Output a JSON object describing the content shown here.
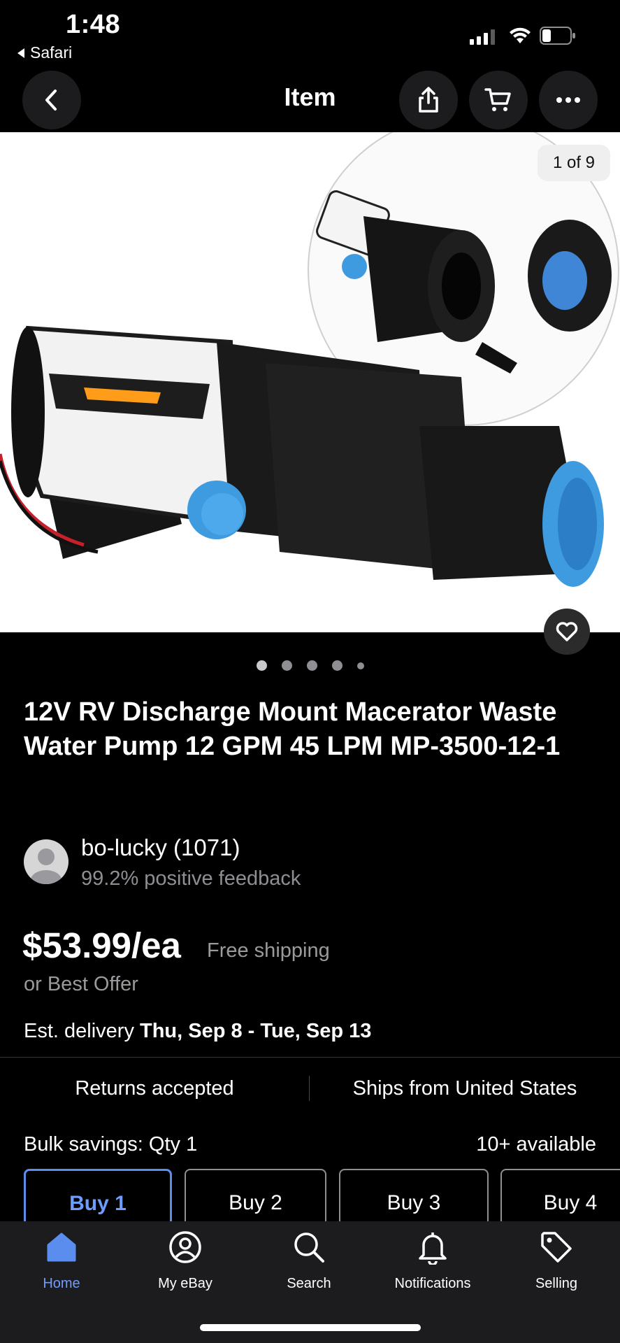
{
  "status_bar": {
    "time": "1:48",
    "back_app": "Safari"
  },
  "nav": {
    "title": "Item",
    "back_icon": "chevron-left-icon",
    "share_icon": "share-icon",
    "cart_icon": "cart-icon",
    "more_icon": "more-icon"
  },
  "gallery": {
    "counter": "1 of 9",
    "page_count": 5,
    "active_page": 1
  },
  "item": {
    "title": "12V RV Discharge Mount Macerator Waste Water Pump 12 GPM 45 LPM MP-3500-12-1",
    "seller_name": "bo-lucky (1071)",
    "seller_feedback": "99.2% positive feedback",
    "price": "$53.99/ea",
    "shipping": "Free shipping",
    "best_offer": "or Best Offer",
    "delivery_prefix": "Est. delivery ",
    "delivery_dates": "Thu, Sep 8 - Tue, Sep 13",
    "returns": "Returns accepted",
    "ships_from": "Ships from United States",
    "bulk_label": "Bulk savings: Qty 1",
    "available": "10+ available",
    "quantity_options": [
      "Buy 1",
      "Buy 2",
      "Buy 3",
      "Buy 4"
    ],
    "selected_quantity": "Buy 1"
  },
  "tabbar": {
    "items": [
      {
        "label": "Home",
        "icon": "home-icon",
        "active": true
      },
      {
        "label": "My eBay",
        "icon": "profile-icon",
        "active": false
      },
      {
        "label": "Search",
        "icon": "search-icon",
        "active": false
      },
      {
        "label": "Notifications",
        "icon": "bell-icon",
        "active": false
      },
      {
        "label": "Selling",
        "icon": "tag-icon",
        "active": false
      }
    ]
  },
  "colors": {
    "accent": "#5b8def",
    "background": "#000000",
    "secondary_text": "#8e8e93"
  }
}
